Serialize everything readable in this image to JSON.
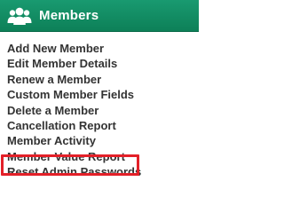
{
  "header": {
    "title": "Members",
    "icon": "users-group-icon",
    "background": "#11875f",
    "text_color": "#ffffff"
  },
  "menu": {
    "items": [
      {
        "label": "Add New Member"
      },
      {
        "label": "Edit Member Details"
      },
      {
        "label": "Renew a Member"
      },
      {
        "label": "Custom Member Fields"
      },
      {
        "label": "Delete a Member"
      },
      {
        "label": "Cancellation Report"
      },
      {
        "label": "Member Activity"
      },
      {
        "label": "Member Value Report",
        "highlighted": true
      },
      {
        "label": "Reset Admin Passwords"
      }
    ],
    "text_color": "#333333",
    "highlight_color": "#e32028"
  }
}
